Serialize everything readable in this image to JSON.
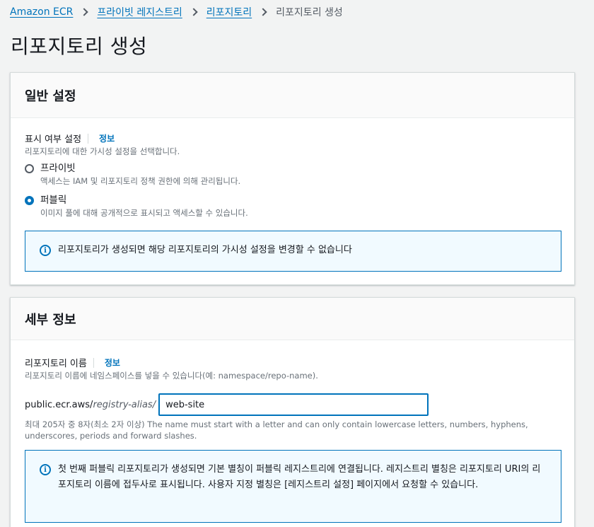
{
  "breadcrumb": {
    "items": [
      "Amazon ECR",
      "프라이빗 레지스트리",
      "리포지토리"
    ],
    "current": "리포지토리 생성"
  },
  "page_title": "리포지토리 생성",
  "general": {
    "title": "일반 설정",
    "visibility_label": "표시 여부 설정",
    "info_label": "정보",
    "visibility_desc": "리포지토리에 대한 가시성 설정을 선택합니다.",
    "options": [
      {
        "label": "프라이빗",
        "desc": "액세스는 IAM 및 리포지토리 정책 권한에 의해 관리됩니다.",
        "selected": false
      },
      {
        "label": "퍼블릭",
        "desc": "이미지 풀에 대해 공개적으로 표시되고 액세스할 수 있습니다.",
        "selected": true
      }
    ],
    "alert": "리포지토리가 생성되면 해당 리포지토리의 가시성 설정을 변경할 수 없습니다"
  },
  "details": {
    "title": "세부 정보",
    "name_label": "리포지토리 이름",
    "info_label": "정보",
    "name_desc": "리포지토리 이름에 네임스페이스를 넣을 수 있습니다(예: namespace/repo-name).",
    "uri_prefix": "public.ecr.aws/",
    "uri_alias": "registry-alias/",
    "repo_name_value": "web-site",
    "constraint": "최대 205자 중 8자(최소 2자 이상) The name must start with a letter and can only contain lowercase letters, numbers, hyphens, underscores, periods and forward slashes.",
    "alert": "첫 번째 퍼블릭 리포지토리가 생성되면 기본 별칭이 퍼블릭 레지스트리에 연결됩니다. 레지스트리 별칭은 리포지토리 URI의 리포지토리 이름에 접두사로 표시됩니다. 사용자 지정 별칭은 [레지스트리 설정] 페이지에서 요청할 수 있습니다."
  },
  "colors": {
    "accent": "#0073bb",
    "background": "#f2f3f3",
    "alert_bg": "#f1faff"
  }
}
